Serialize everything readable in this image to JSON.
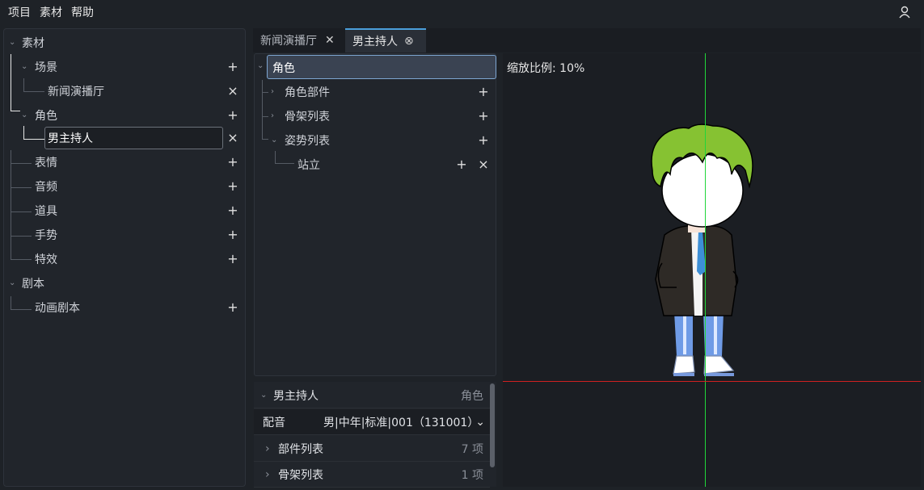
{
  "menu": [
    "项目",
    "素材",
    "帮助"
  ],
  "left_tree": {
    "root1": "素材",
    "scene": "场景",
    "scene_child": "新闻演播厅",
    "role": "角色",
    "role_child": "男主持人",
    "expression": "表情",
    "audio": "音频",
    "prop": "道具",
    "gesture": "手势",
    "effect": "特效",
    "root2": "剧本",
    "anim_script": "动画剧本"
  },
  "tabs": [
    {
      "label": "新闻演播厅"
    },
    {
      "label": "男主持人"
    }
  ],
  "role_tree": {
    "name_value": "角色",
    "parts": "角色部件",
    "skeleton": "骨架列表",
    "pose": "姿势列表",
    "stand": "站立"
  },
  "props": {
    "header_name": "男主持人",
    "header_type": "角色",
    "voice_label": "配音",
    "voice_value": "男|中年|标准|001（131001）",
    "parts_label": "部件列表",
    "parts_count": "7 项",
    "skeleton_label": "骨架列表",
    "skeleton_count": "1 项"
  },
  "canvas": {
    "zoom_label": "缩放比例: 10%"
  },
  "colors": {
    "accent": "#4a9eda",
    "y_axis": "#21d63a",
    "x_axis": "#d02020",
    "hair": "#86c232"
  }
}
